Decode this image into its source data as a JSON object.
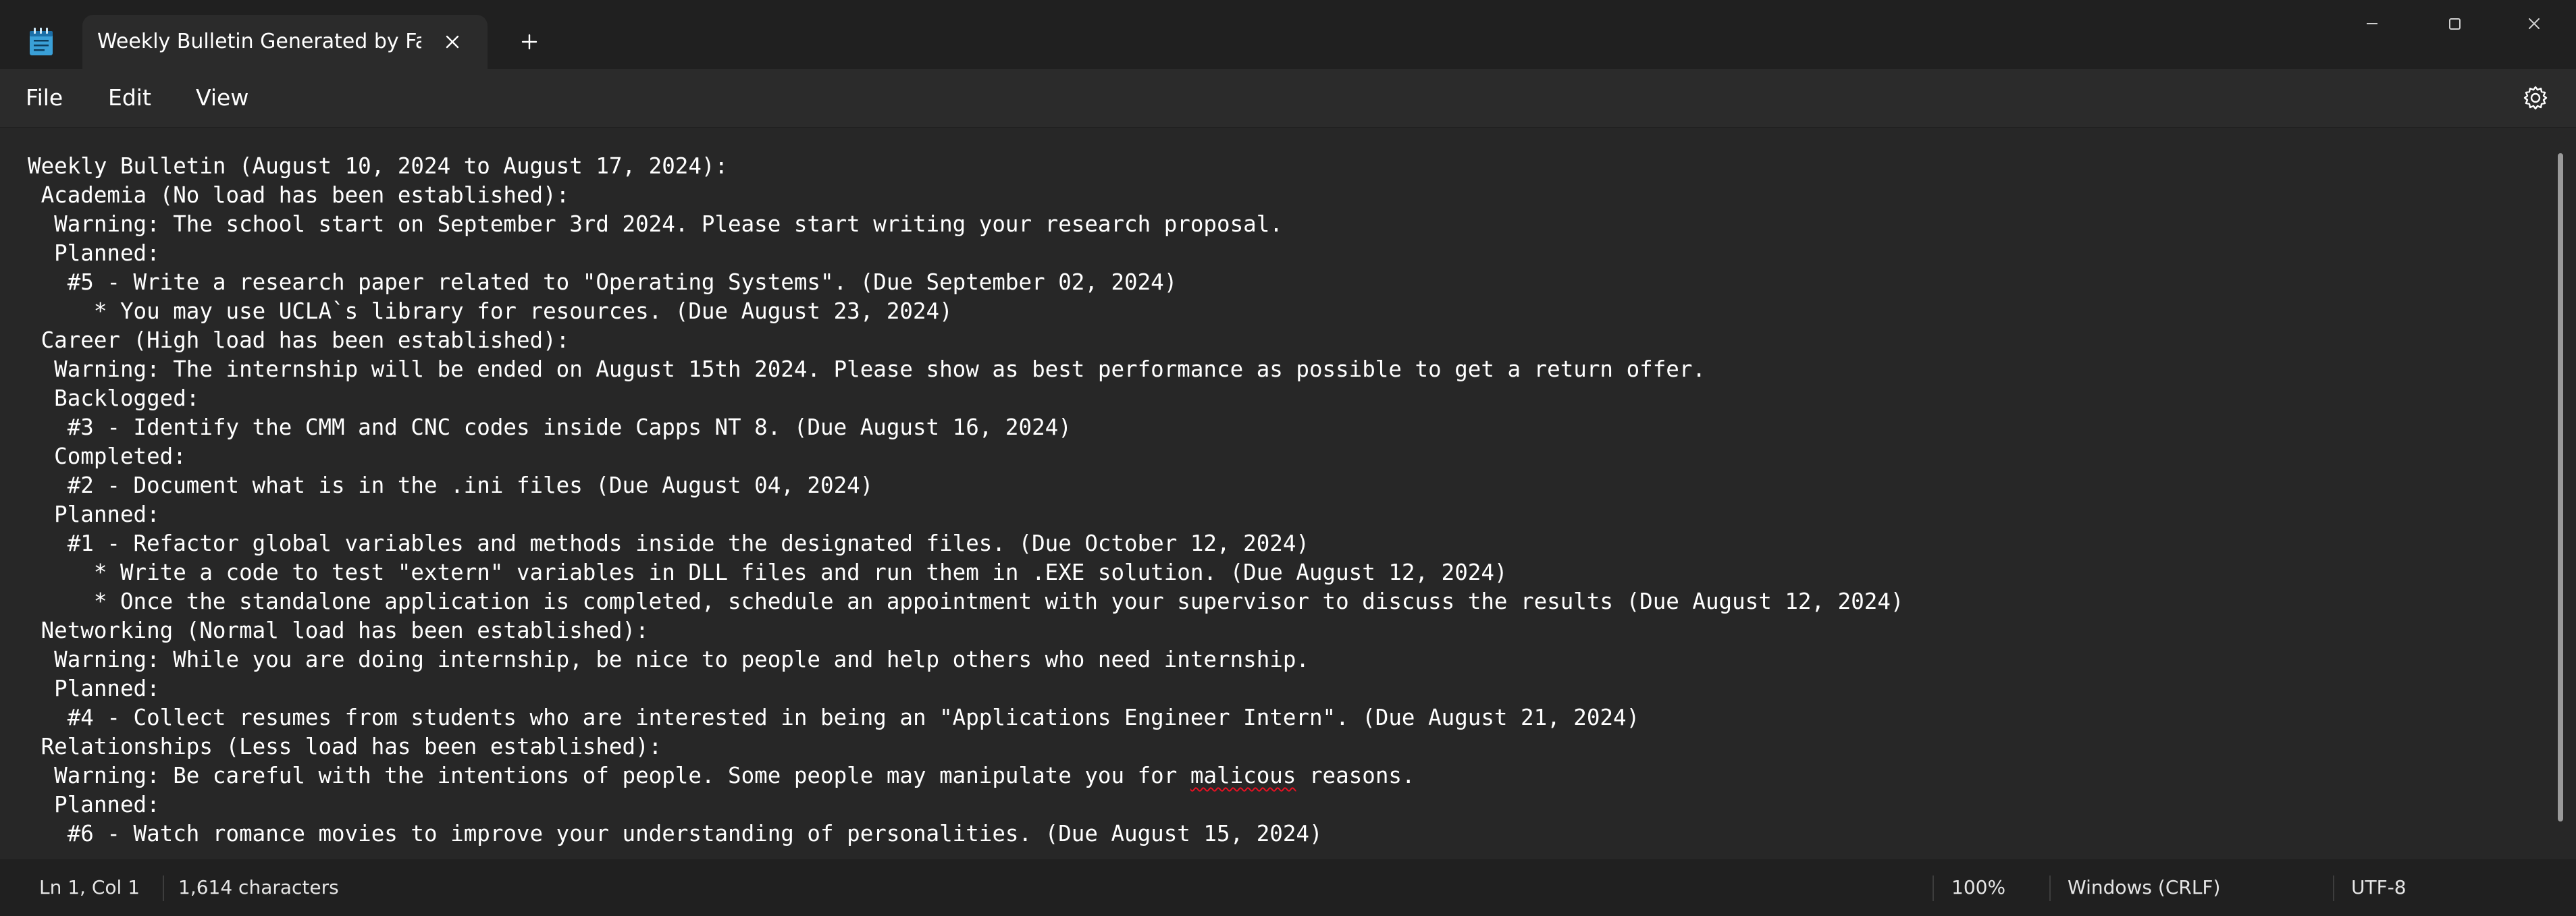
{
  "window": {
    "tab_title": "Weekly Bulletin Generated by Falco",
    "app_icon": "notepad-icon",
    "controls": [
      "minimize-icon",
      "maximize-icon",
      "close-icon"
    ]
  },
  "menu": {
    "file": "File",
    "edit": "Edit",
    "view": "View",
    "settings_icon": "gear-icon"
  },
  "document": {
    "lines": [
      "Weekly Bulletin (August 10, 2024 to August 17, 2024):",
      " Academia (No load has been established):",
      "  Warning: The school start on September 3rd 2024. Please start writing your research proposal.",
      "  Planned:",
      "   #5 - Write a research paper related to \"Operating Systems\". (Due September 02, 2024)",
      "     * You may use UCLA`s library for resources. (Due August 23, 2024)",
      " Career (High load has been established):",
      "  Warning: The internship will be ended on August 15th 2024. Please show as best performance as possible to get a return offer.",
      "  Backlogged:",
      "   #3 - Identify the CMM and CNC codes inside Capps NT 8. (Due August 16, 2024)",
      "  Completed:",
      "   #2 - Document what is in the .ini files (Due August 04, 2024)",
      "  Planned:",
      "   #1 - Refactor global variables and methods inside the designated files. (Due October 12, 2024)",
      "     * Write a code to test \"extern\" variables in DLL files and run them in .EXE solution. (Due August 12, 2024)",
      "     * Once the standalone application is completed, schedule an appointment with your supervisor to discuss the results (Due August 12, 2024)",
      " Networking (Normal load has been established):",
      "  Warning: While you are doing internship, be nice to people and help others who need internship.",
      "  Planned:",
      "   #4 - Collect resumes from students who are interested in being an \"Applications Engineer Intern\". (Due August 21, 2024)",
      " Relationships (Less load has been established):",
      "  Warning: Be careful with the intentions of people. Some people may manipulate you for ",
      "  Planned:",
      "   #6 - Watch romance movies to improve your understanding of personalities. (Due August 15, 2024)"
    ],
    "misspelled_word": "malicous",
    "after_misspelled": " reasons."
  },
  "status": {
    "position": "Ln 1, Col 1",
    "characters": "1,614 characters",
    "zoom": "100%",
    "line_ending": "Windows (CRLF)",
    "encoding": "UTF-8"
  }
}
